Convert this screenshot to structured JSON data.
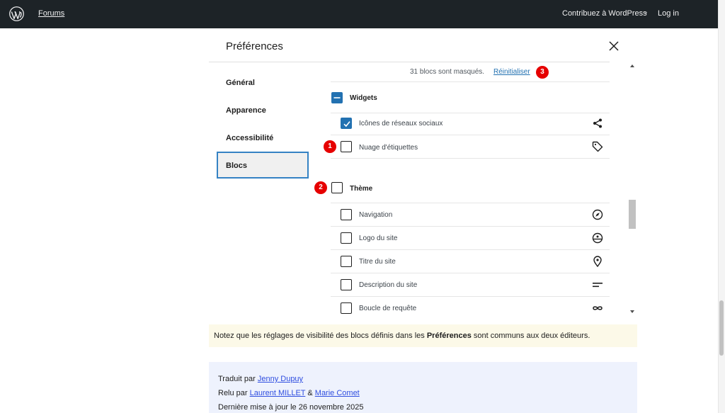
{
  "topbar": {
    "forums": "Forums",
    "contribute": "Contribuez à WordPress",
    "separator": "•",
    "login": "Log in"
  },
  "modal": {
    "title": "Préférences",
    "nav": [
      "Général",
      "Apparence",
      "Accessibilité",
      "Blocs"
    ],
    "active_nav": "Blocs"
  },
  "blocks_panel": {
    "hidden_count": "31 blocs sont masqués.",
    "reset": "Réinitialiser",
    "groups": [
      {
        "name": "Widgets",
        "state": "partial",
        "items": [
          {
            "label": "Icônes de réseaux sociaux",
            "checked": true,
            "icon": "share-icon"
          },
          {
            "label": "Nuage d'étiquettes",
            "checked": false,
            "icon": "tag-icon"
          }
        ]
      },
      {
        "name": "Thème",
        "state": "unchecked",
        "items": [
          {
            "label": "Navigation",
            "checked": false,
            "icon": "compass-icon"
          },
          {
            "label": "Logo du site",
            "checked": false,
            "icon": "site-logo-icon"
          },
          {
            "label": "Titre du site",
            "checked": false,
            "icon": "map-pin-icon"
          },
          {
            "label": "Description du site",
            "checked": false,
            "icon": "align-left-icon"
          },
          {
            "label": "Boucle de requête",
            "checked": false,
            "icon": "loop-icon"
          }
        ]
      }
    ]
  },
  "markers": [
    "1",
    "2",
    "3"
  ],
  "note": {
    "before": "Notez que les réglages de visibilité des blocs définis dans les ",
    "bold": "Préférences",
    "after": " sont communs aux deux éditeurs."
  },
  "credits": {
    "translated_prefix": "Traduit par ",
    "translator": "Jenny Dupuy",
    "reviewed_prefix": "Relu par ",
    "reviewer1": "Laurent MILLET",
    "amp": " & ",
    "reviewer2": "Marie Comet",
    "updated": "Dernière mise à jour le 26 novembre 2025"
  },
  "colors": {
    "admin_bar": "#1d2327",
    "accent": "#2271b1",
    "marker": "#e60000",
    "note_bg": "#fcf9e8",
    "credit_bg": "#eef2fd"
  }
}
